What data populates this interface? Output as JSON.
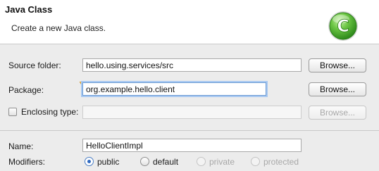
{
  "header": {
    "title": "Java Class",
    "description": "Create a new Java class.",
    "logo_letter": "C",
    "logo_color": "#43a72b"
  },
  "form": {
    "source_folder": {
      "label": "Source folder:",
      "value": "hello.using.services/src",
      "browse_label": "Browse..."
    },
    "package": {
      "label": "Package:",
      "value": "org.example.hello.client",
      "browse_label": "Browse..."
    },
    "enclosing_type": {
      "label": "Enclosing type:",
      "value": "",
      "browse_label": "Browse...",
      "checked": false
    },
    "name": {
      "label": "Name:",
      "value": "HelloClientImpl"
    },
    "modifiers": {
      "label": "Modifiers:",
      "options": [
        {
          "label": "public",
          "selected": true,
          "enabled": true
        },
        {
          "label": "default",
          "selected": false,
          "enabled": true
        },
        {
          "label": "private",
          "selected": false,
          "enabled": false
        },
        {
          "label": "protected",
          "selected": false,
          "enabled": false
        }
      ]
    }
  }
}
